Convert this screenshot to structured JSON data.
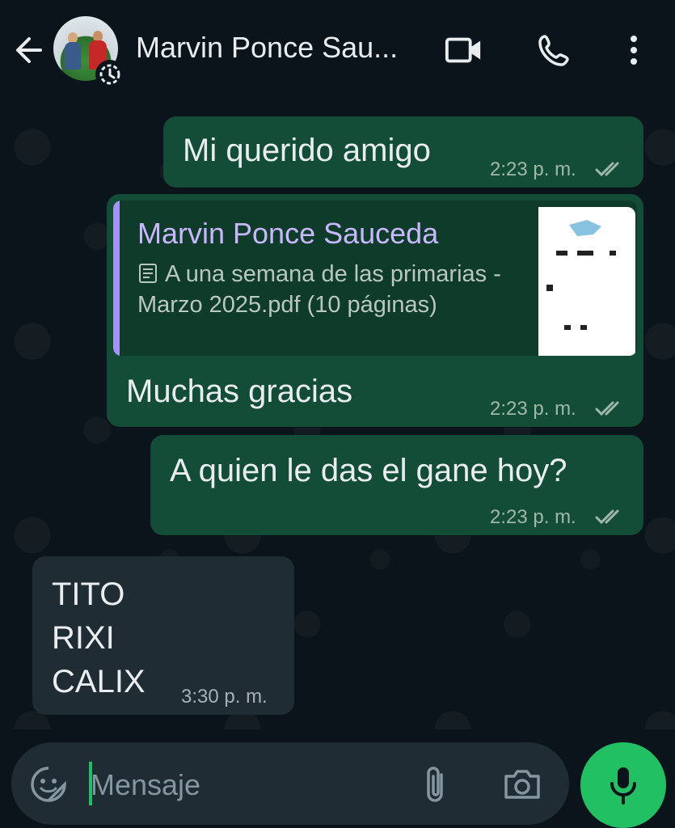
{
  "header": {
    "contact_name": "Marvin Ponce Sau...",
    "icons": [
      "back-arrow-icon",
      "status-timer-icon",
      "video-call-icon",
      "phone-call-icon",
      "more-vert-icon"
    ]
  },
  "messages": [
    {
      "text": "Mi querido amigo",
      "time": "2:23 p. m.",
      "direction": "out"
    },
    {
      "reply_to": {
        "name": "Marvin Ponce Sauceda",
        "file_text": "A una semana de las primarias - Marzo 2025.pdf (10 páginas)"
      },
      "text": "Muchas gracias",
      "time": "2:23 p. m.",
      "direction": "out"
    },
    {
      "text": "A quien le das el gane hoy?",
      "time": "2:23 p. m.",
      "direction": "out"
    },
    {
      "lines": [
        "TITO",
        "RIXI",
        "CALIX"
      ],
      "time": "3:30 p. m.",
      "direction": "in"
    }
  ],
  "composer": {
    "placeholder": "Mensaje"
  },
  "colors": {
    "background": "#0b141a",
    "outgoing_bubble": "#144d37",
    "incoming_bubble": "#1f2c34",
    "accent_green": "#21c063",
    "quote_bar": "#a694f4"
  }
}
